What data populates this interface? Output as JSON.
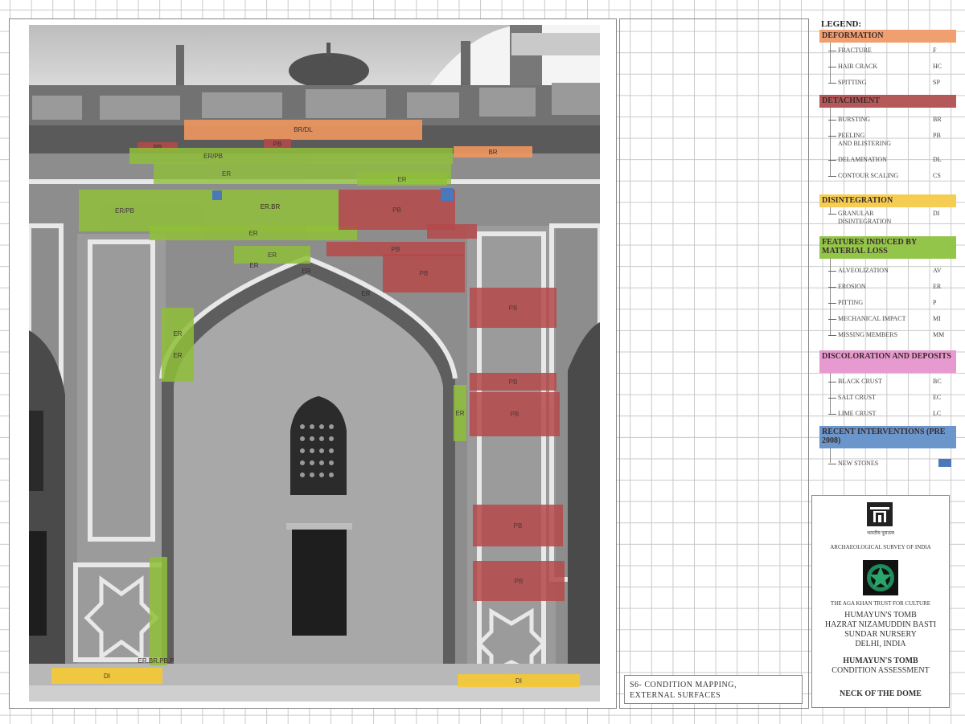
{
  "photo": {
    "zones": [
      {
        "label": "BR/DL",
        "color": "#f0975f"
      },
      {
        "label": "BR",
        "color": "#f0975f"
      },
      {
        "label": "PB",
        "color": "#b5494a"
      },
      {
        "label": "ER",
        "color": "#8fbf3a"
      },
      {
        "label": "ER/PB",
        "color": "#8fbf3a"
      },
      {
        "label": "ER.BR",
        "color": "#8fbf3a"
      },
      {
        "label": "ER.BR.PB.P",
        "color": "#8fbf3a"
      },
      {
        "label": "DI",
        "color": "#f5c933"
      }
    ]
  },
  "legend": {
    "title": "LEGEND:",
    "categories": [
      {
        "name": "DEFORMATION",
        "color": "#f0a070",
        "items": [
          {
            "label": "FRACTURE",
            "code": "F"
          },
          {
            "label": "HAIR CRACK",
            "code": "HC"
          },
          {
            "label": "SPITTING",
            "code": "SP"
          }
        ]
      },
      {
        "name": "DETACHMENT",
        "color": "#b5585a",
        "items": [
          {
            "label": "BURSTING",
            "code": "BR"
          },
          {
            "label": "PEELING\nAND BLISTERING",
            "code": "PB"
          },
          {
            "label": "DELAMINATION",
            "code": "DL"
          },
          {
            "label": "CONTOUR SCALING",
            "code": "CS"
          }
        ]
      },
      {
        "name": "DISINTEGRATION",
        "color": "#f5cd52",
        "items": [
          {
            "label": "GRANULAR\nDISINTEGRATION",
            "code": "DI"
          }
        ]
      },
      {
        "name": "FEATURES INDUCED BY MATERIAL LOSS",
        "color": "#93c54b",
        "items": [
          {
            "label": "ALVEOLIZATION",
            "code": "AV"
          },
          {
            "label": "EROSION",
            "code": "ER"
          },
          {
            "label": "PITTING",
            "code": "P"
          },
          {
            "label": "MECHANICAL IMPACT",
            "code": "MI"
          },
          {
            "label": "MISSING MEMBERS",
            "code": "MM"
          }
        ]
      },
      {
        "name": "DISCOLORATION AND DEPOSITS",
        "color": "#e79ad0",
        "items": [
          {
            "label": "BLACK CRUST",
            "code": "BC"
          },
          {
            "label": "SALT CRUST",
            "code": "EC"
          },
          {
            "label": "LIME CRUST",
            "code": "LC"
          }
        ]
      },
      {
        "name": "RECENT INTERVENTIONS (PRE 2008)",
        "color": "#6a96cc",
        "items": [
          {
            "label": "NEW STONES",
            "code": ""
          }
        ]
      }
    ],
    "new_stone_color": "#4a78b8"
  },
  "title_block": {
    "org1": "ARCHAEOLOGICAL SURVEY OF INDIA",
    "org1_script": "भारतीय पुरातत्व",
    "org2": "THE AGA KHAN TRUST FOR CULTURE",
    "site_line1": "HUMAYUN'S TOMB",
    "site_line2": "HAZRAT NIZAMUDDIN BASTI",
    "site_line3": "SUNDAR NURSERY",
    "site_line4": "DELHI, INDIA",
    "project": "HUMAYUN'S TOMB",
    "project_sub": "CONDITION ASSESSMENT",
    "sheet": "NECK OF THE DOME"
  },
  "caption": {
    "line1": "S6- CONDITION  MAPPING,",
    "line2": "EXTERNAL SURFACES"
  }
}
